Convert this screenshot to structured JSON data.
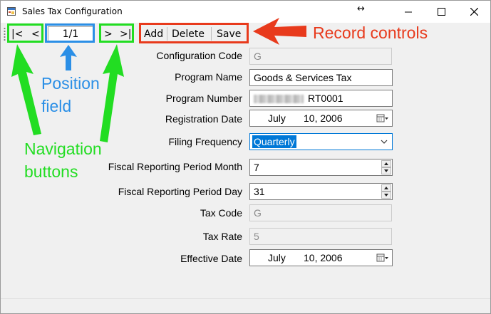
{
  "window": {
    "title": "Sales Tax Configuration",
    "resize_glyph": "↔"
  },
  "toolbar": {
    "first_label": "|<",
    "prev_label": "<",
    "position_value": "1/1",
    "next_label": ">",
    "last_label": ">|",
    "add_label": "Add",
    "delete_label": "Delete",
    "save_label": "Save"
  },
  "form": {
    "configuration_code": {
      "label": "Configuration Code",
      "value": "G"
    },
    "program_name": {
      "label": "Program Name",
      "value": "Goods & Services Tax"
    },
    "program_number": {
      "label": "Program Number",
      "value": "RT0001"
    },
    "registration_date": {
      "label": "Registration Date",
      "month": "July",
      "day_year": "10, 2006"
    },
    "filing_frequency": {
      "label": "Filing Frequency",
      "value": "Quarterly"
    },
    "fiscal_period_month": {
      "label": "Fiscal Reporting Period Month",
      "value": "7"
    },
    "fiscal_period_day": {
      "label": "Fiscal Reporting Period Day",
      "value": "31"
    },
    "tax_code": {
      "label": "Tax Code",
      "value": "G"
    },
    "tax_rate": {
      "label": "Tax Rate",
      "value": "5"
    },
    "effective_date": {
      "label": "Effective Date",
      "month": "July",
      "day_year": "10, 2006"
    }
  },
  "annotations": {
    "record_controls": "Record controls",
    "position_field_line1": "Position",
    "position_field_line2": "field",
    "navigation_line1": "Navigation",
    "navigation_line2": "buttons"
  },
  "colors": {
    "navigation_highlight": "#22dd22",
    "position_highlight": "#2b8fe6",
    "record_highlight": "#e83a1c",
    "selection": "#0078d7"
  }
}
